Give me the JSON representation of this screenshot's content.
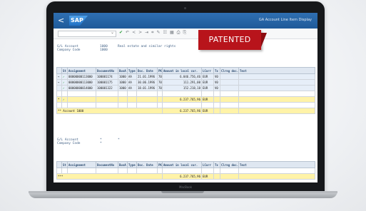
{
  "header": {
    "back": "<",
    "logo": "SAP",
    "title": "GA Account Line Item Display"
  },
  "toolbar": {
    "select_arrow": "⌄",
    "icons": [
      "✔",
      "↶",
      "<",
      ">",
      "⇥",
      "⌗",
      "✎",
      "☷",
      "▦",
      "⎙",
      "⎘"
    ]
  },
  "badge": "PATENTED",
  "block1": {
    "gl_label": "G/L Account",
    "gl_value": "1000",
    "gl_desc": "Real estate and similar rights",
    "cc_label": "Company Code",
    "cc_value": "1000"
  },
  "table1": {
    "columns": [
      "St",
      "Assignment",
      "DocumentNo",
      "BusA",
      "Type",
      "Doc. Date",
      "PK",
      "Amount in local cur.",
      "LCurr",
      "Tx",
      "Clrng doc.",
      "Text"
    ],
    "rows": [
      {
        "mark": "→",
        "st": "✓",
        "assignment": "00000000113000",
        "docno": "100001174",
        "busa": "1000",
        "type": "AA",
        "date": "21.01.1996",
        "pk": "70",
        "amount": "6.046.756,46",
        "lcurr": "EUR",
        "tx": "V0",
        "clr": "",
        "text": ""
      },
      {
        "mark": "→",
        "st": "✓",
        "assignment": "00000000113000",
        "docno": "100001175",
        "busa": "1000",
        "type": "AA",
        "date": "30.06.1996",
        "pk": "70",
        "amount": "111.291,00",
        "lcurr": "EUR",
        "tx": "V0",
        "clr": "",
        "text": ""
      },
      {
        "mark": "",
        "st": "✓",
        "assignment": "00000000014000",
        "docno": "100001322",
        "busa": "1000",
        "type": "AA",
        "date": "18.01.1996",
        "pk": "70",
        "amount": "152.218,18",
        "lcurr": "EUR",
        "tx": "V0",
        "clr": "",
        "text": ""
      }
    ],
    "subtotal": {
      "label": "*",
      "st": "✓",
      "amount": "6.237.765,96",
      "lcurr": "EUR"
    },
    "total": {
      "label": "** Account 1000",
      "amount": "6.237.765,96",
      "lcurr": "EUR"
    }
  },
  "block2": {
    "gl_label": "G/L Account",
    "gl_value": "*",
    "gl_desc": "*",
    "cc_label": "Company Code",
    "cc_value": "*"
  },
  "table2": {
    "columns": [
      "St",
      "Assignment",
      "DocumentNo",
      "BusA",
      "Type",
      "Doc. Date",
      "PK",
      "Amount in local cur.",
      "LCurr",
      "Tx",
      "Clrng doc.",
      "Text"
    ],
    "total": {
      "label": "***",
      "amount": "6.237.765,96",
      "lcurr": "EUR"
    }
  },
  "device_brand": "MacBook"
}
